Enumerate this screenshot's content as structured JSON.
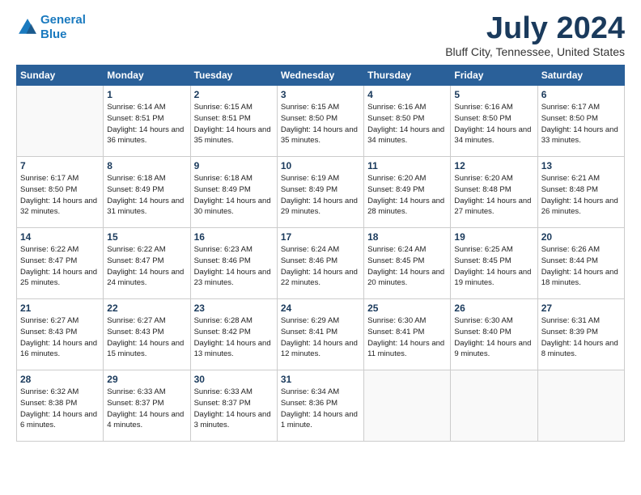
{
  "header": {
    "logo_line1": "General",
    "logo_line2": "Blue",
    "title": "July 2024",
    "location": "Bluff City, Tennessee, United States"
  },
  "days_of_week": [
    "Sunday",
    "Monday",
    "Tuesday",
    "Wednesday",
    "Thursday",
    "Friday",
    "Saturday"
  ],
  "weeks": [
    [
      {
        "day": "",
        "sunrise": "",
        "sunset": "",
        "daylight": ""
      },
      {
        "day": "1",
        "sunrise": "Sunrise: 6:14 AM",
        "sunset": "Sunset: 8:51 PM",
        "daylight": "Daylight: 14 hours and 36 minutes."
      },
      {
        "day": "2",
        "sunrise": "Sunrise: 6:15 AM",
        "sunset": "Sunset: 8:51 PM",
        "daylight": "Daylight: 14 hours and 35 minutes."
      },
      {
        "day": "3",
        "sunrise": "Sunrise: 6:15 AM",
        "sunset": "Sunset: 8:50 PM",
        "daylight": "Daylight: 14 hours and 35 minutes."
      },
      {
        "day": "4",
        "sunrise": "Sunrise: 6:16 AM",
        "sunset": "Sunset: 8:50 PM",
        "daylight": "Daylight: 14 hours and 34 minutes."
      },
      {
        "day": "5",
        "sunrise": "Sunrise: 6:16 AM",
        "sunset": "Sunset: 8:50 PM",
        "daylight": "Daylight: 14 hours and 34 minutes."
      },
      {
        "day": "6",
        "sunrise": "Sunrise: 6:17 AM",
        "sunset": "Sunset: 8:50 PM",
        "daylight": "Daylight: 14 hours and 33 minutes."
      }
    ],
    [
      {
        "day": "7",
        "sunrise": "Sunrise: 6:17 AM",
        "sunset": "Sunset: 8:50 PM",
        "daylight": "Daylight: 14 hours and 32 minutes."
      },
      {
        "day": "8",
        "sunrise": "Sunrise: 6:18 AM",
        "sunset": "Sunset: 8:49 PM",
        "daylight": "Daylight: 14 hours and 31 minutes."
      },
      {
        "day": "9",
        "sunrise": "Sunrise: 6:18 AM",
        "sunset": "Sunset: 8:49 PM",
        "daylight": "Daylight: 14 hours and 30 minutes."
      },
      {
        "day": "10",
        "sunrise": "Sunrise: 6:19 AM",
        "sunset": "Sunset: 8:49 PM",
        "daylight": "Daylight: 14 hours and 29 minutes."
      },
      {
        "day": "11",
        "sunrise": "Sunrise: 6:20 AM",
        "sunset": "Sunset: 8:49 PM",
        "daylight": "Daylight: 14 hours and 28 minutes."
      },
      {
        "day": "12",
        "sunrise": "Sunrise: 6:20 AM",
        "sunset": "Sunset: 8:48 PM",
        "daylight": "Daylight: 14 hours and 27 minutes."
      },
      {
        "day": "13",
        "sunrise": "Sunrise: 6:21 AM",
        "sunset": "Sunset: 8:48 PM",
        "daylight": "Daylight: 14 hours and 26 minutes."
      }
    ],
    [
      {
        "day": "14",
        "sunrise": "Sunrise: 6:22 AM",
        "sunset": "Sunset: 8:47 PM",
        "daylight": "Daylight: 14 hours and 25 minutes."
      },
      {
        "day": "15",
        "sunrise": "Sunrise: 6:22 AM",
        "sunset": "Sunset: 8:47 PM",
        "daylight": "Daylight: 14 hours and 24 minutes."
      },
      {
        "day": "16",
        "sunrise": "Sunrise: 6:23 AM",
        "sunset": "Sunset: 8:46 PM",
        "daylight": "Daylight: 14 hours and 23 minutes."
      },
      {
        "day": "17",
        "sunrise": "Sunrise: 6:24 AM",
        "sunset": "Sunset: 8:46 PM",
        "daylight": "Daylight: 14 hours and 22 minutes."
      },
      {
        "day": "18",
        "sunrise": "Sunrise: 6:24 AM",
        "sunset": "Sunset: 8:45 PM",
        "daylight": "Daylight: 14 hours and 20 minutes."
      },
      {
        "day": "19",
        "sunrise": "Sunrise: 6:25 AM",
        "sunset": "Sunset: 8:45 PM",
        "daylight": "Daylight: 14 hours and 19 minutes."
      },
      {
        "day": "20",
        "sunrise": "Sunrise: 6:26 AM",
        "sunset": "Sunset: 8:44 PM",
        "daylight": "Daylight: 14 hours and 18 minutes."
      }
    ],
    [
      {
        "day": "21",
        "sunrise": "Sunrise: 6:27 AM",
        "sunset": "Sunset: 8:43 PM",
        "daylight": "Daylight: 14 hours and 16 minutes."
      },
      {
        "day": "22",
        "sunrise": "Sunrise: 6:27 AM",
        "sunset": "Sunset: 8:43 PM",
        "daylight": "Daylight: 14 hours and 15 minutes."
      },
      {
        "day": "23",
        "sunrise": "Sunrise: 6:28 AM",
        "sunset": "Sunset: 8:42 PM",
        "daylight": "Daylight: 14 hours and 13 minutes."
      },
      {
        "day": "24",
        "sunrise": "Sunrise: 6:29 AM",
        "sunset": "Sunset: 8:41 PM",
        "daylight": "Daylight: 14 hours and 12 minutes."
      },
      {
        "day": "25",
        "sunrise": "Sunrise: 6:30 AM",
        "sunset": "Sunset: 8:41 PM",
        "daylight": "Daylight: 14 hours and 11 minutes."
      },
      {
        "day": "26",
        "sunrise": "Sunrise: 6:30 AM",
        "sunset": "Sunset: 8:40 PM",
        "daylight": "Daylight: 14 hours and 9 minutes."
      },
      {
        "day": "27",
        "sunrise": "Sunrise: 6:31 AM",
        "sunset": "Sunset: 8:39 PM",
        "daylight": "Daylight: 14 hours and 8 minutes."
      }
    ],
    [
      {
        "day": "28",
        "sunrise": "Sunrise: 6:32 AM",
        "sunset": "Sunset: 8:38 PM",
        "daylight": "Daylight: 14 hours and 6 minutes."
      },
      {
        "day": "29",
        "sunrise": "Sunrise: 6:33 AM",
        "sunset": "Sunset: 8:37 PM",
        "daylight": "Daylight: 14 hours and 4 minutes."
      },
      {
        "day": "30",
        "sunrise": "Sunrise: 6:33 AM",
        "sunset": "Sunset: 8:37 PM",
        "daylight": "Daylight: 14 hours and 3 minutes."
      },
      {
        "day": "31",
        "sunrise": "Sunrise: 6:34 AM",
        "sunset": "Sunset: 8:36 PM",
        "daylight": "Daylight: 14 hours and 1 minute."
      },
      {
        "day": "",
        "sunrise": "",
        "sunset": "",
        "daylight": ""
      },
      {
        "day": "",
        "sunrise": "",
        "sunset": "",
        "daylight": ""
      },
      {
        "day": "",
        "sunrise": "",
        "sunset": "",
        "daylight": ""
      }
    ]
  ]
}
